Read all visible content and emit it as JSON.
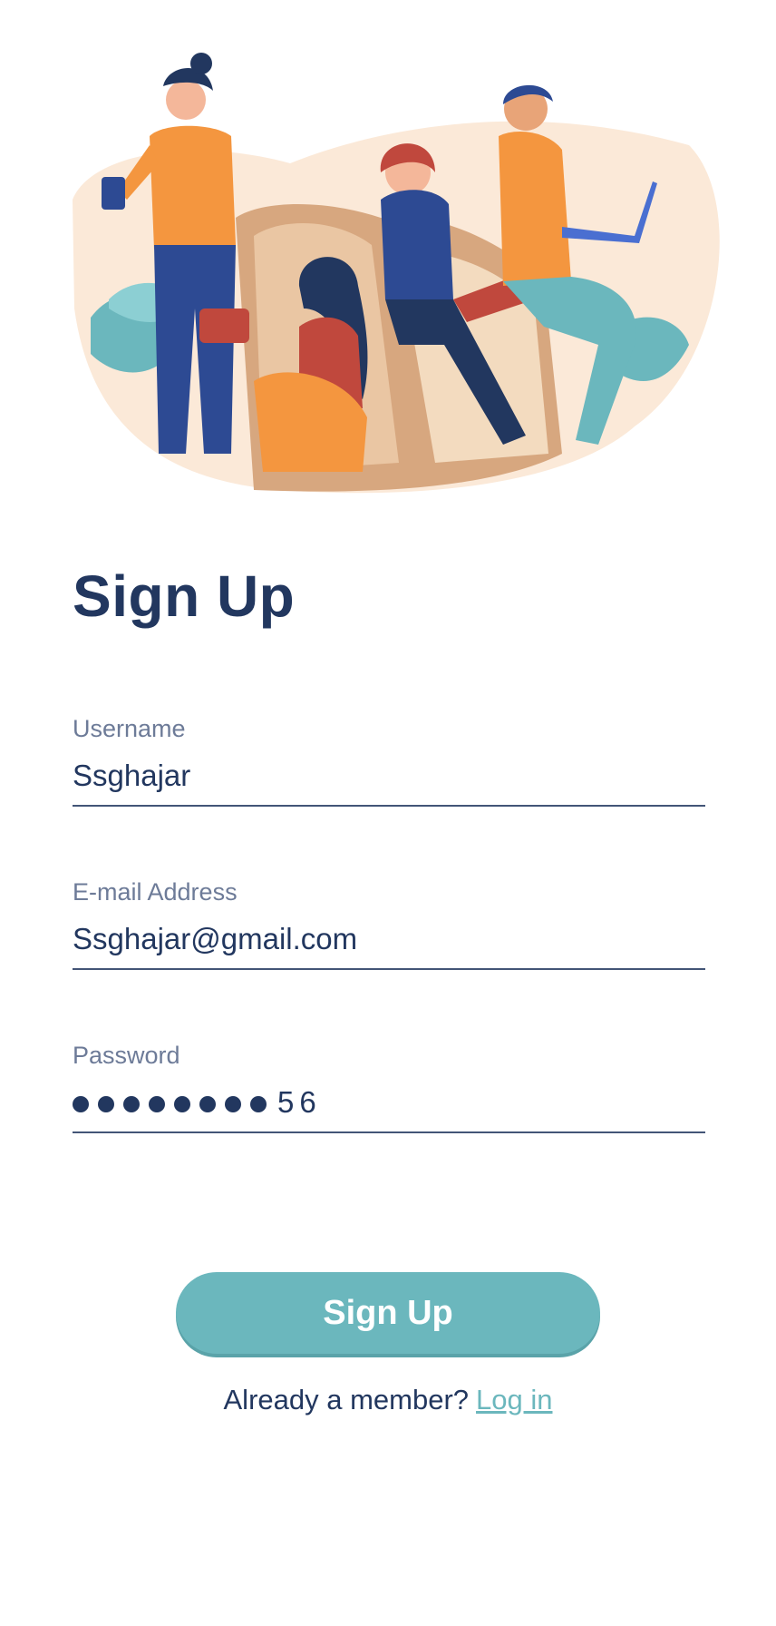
{
  "title": "Sign Up",
  "form": {
    "username": {
      "label": "Username",
      "value": "Ssghajar"
    },
    "email": {
      "label": "E-mail Address",
      "value": "Ssghajar@gmail.com"
    },
    "password": {
      "label": "Password",
      "masked_count": 8,
      "visible_tail": "56"
    }
  },
  "actions": {
    "signup_label": "Sign Up",
    "member_prompt": "Already a member?",
    "login_link": "Log in"
  },
  "colors": {
    "primary_text": "#22375f",
    "label_text": "#6d7b98",
    "accent": "#6bb7bd",
    "orange": "#f4963f",
    "navy": "#22375f"
  },
  "illustration": {
    "icon": "people-with-devices-illustration"
  }
}
